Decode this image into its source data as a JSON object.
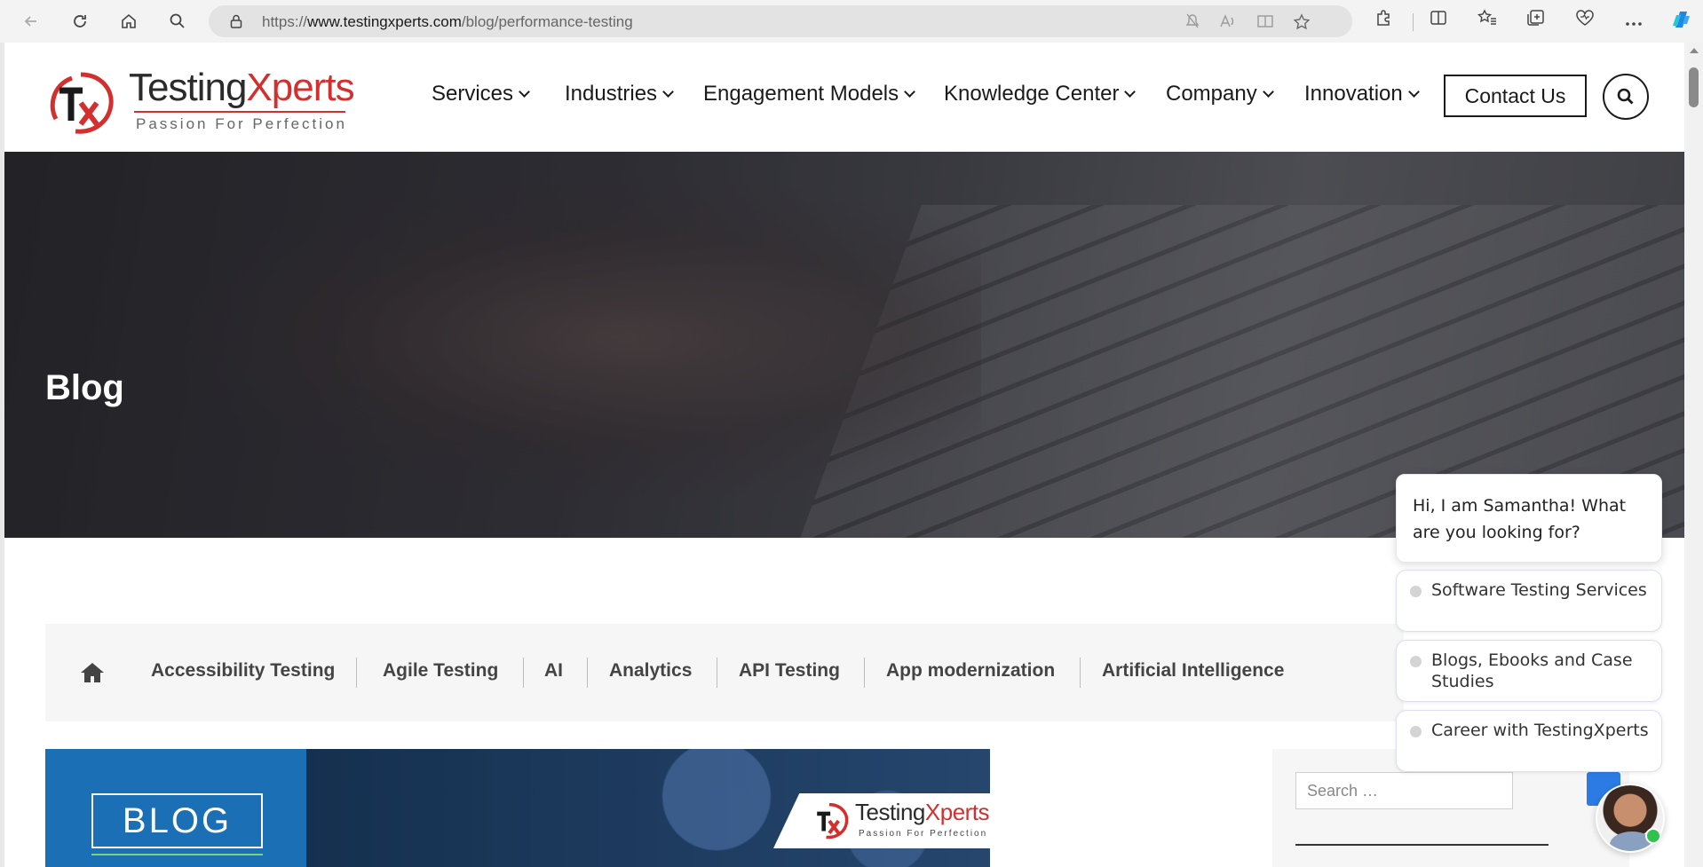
{
  "browser": {
    "url_prefix": "https://",
    "url_domain": "www.testingxperts.com",
    "url_path": "/blog/performance-testing"
  },
  "header": {
    "brand_main": "Testing",
    "brand_accent": "Xperts",
    "tagline": "Passion For Perfection",
    "nav": [
      {
        "label": "Services"
      },
      {
        "label": "Industries"
      },
      {
        "label": "Engagement Models"
      },
      {
        "label": "Knowledge Center"
      },
      {
        "label": "Company"
      },
      {
        "label": "Innovation"
      }
    ],
    "contact_label": "Contact Us"
  },
  "hero": {
    "title": "Blog"
  },
  "categories": [
    "Accessibility Testing",
    "Agile Testing",
    "AI",
    "Analytics",
    "API Testing",
    "App modernization",
    "Artificial Intelligence"
  ],
  "blog_image": {
    "badge": "BLOG",
    "brand_main": "Testing",
    "brand_accent": "Xperts",
    "tagline": "Passion For Perfection"
  },
  "sidebar": {
    "search_placeholder": "Search …"
  },
  "chat": {
    "greeting": "Hi, I am Samantha! What are you looking for?",
    "options": [
      "Software Testing Services",
      "Blogs, Ebooks and Case Studies",
      "Career with TestingXperts"
    ]
  },
  "colors": {
    "brand_red": "#d32f2f",
    "blog_blue": "#1a6fb5",
    "chat_online": "#31c24d"
  }
}
